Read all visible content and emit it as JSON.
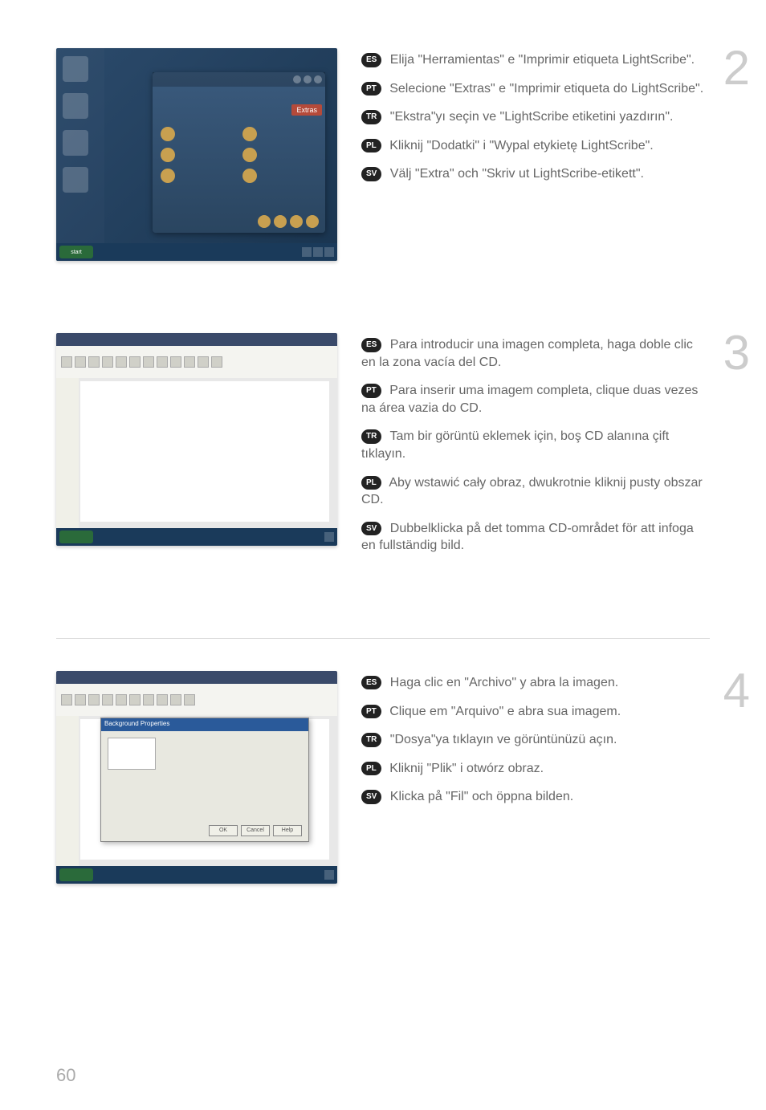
{
  "page_number": "60",
  "steps": [
    {
      "number": "2",
      "image_hint": {
        "type": "desktop",
        "extras_label": "Extras",
        "start_label": "start"
      },
      "instructions": [
        {
          "lang": "ES",
          "text": "Elija \"Herramientas\" e \"Imprimir etiqueta LightScribe\"."
        },
        {
          "lang": "PT",
          "text": "Selecione \"Extras\" e \"Imprimir etiqueta do LightScribe\"."
        },
        {
          "lang": "TR",
          "text": "\"Ekstra\"yı seçin ve \"LightScribe etiketini yazdırın\"."
        },
        {
          "lang": "PL",
          "text": "Kliknij \"Dodatki\" i \"Wypal etykietę LightScribe\"."
        },
        {
          "lang": "SV",
          "text": "Välj \"Extra\" och \"Skriv ut LightScribe-etikett\"."
        }
      ]
    },
    {
      "number": "3",
      "image_hint": {
        "type": "editor-blank"
      },
      "instructions": [
        {
          "lang": "ES",
          "text": "Para introducir una imagen completa, haga doble clic en la zona vacía del CD."
        },
        {
          "lang": "PT",
          "text": "Para inserir uma imagem completa, clique duas vezes na área vazia do CD."
        },
        {
          "lang": "TR",
          "text": "Tam bir görüntü eklemek için, boş CD alanına çift tıklayın."
        },
        {
          "lang": "PL",
          "text": "Aby wstawić cały obraz, dwukrotnie kliknij pusty obszar CD."
        },
        {
          "lang": "SV",
          "text": "Dubbelklicka på det tomma CD-området för att infoga en fullständig bild."
        }
      ]
    },
    {
      "number": "4",
      "image_hint": {
        "type": "editor-dialog",
        "dialog_title": "Background Properties",
        "buttons": [
          "OK",
          "Cancel",
          "Help"
        ]
      },
      "instructions": [
        {
          "lang": "ES",
          "text": "Haga clic en \"Archivo\" y abra la imagen."
        },
        {
          "lang": "PT",
          "text": "Clique em \"Arquivo\" e abra sua imagem."
        },
        {
          "lang": "TR",
          "text": "\"Dosya\"ya tıklayın ve görüntünüzü açın."
        },
        {
          "lang": "PL",
          "text": "Kliknij \"Plik\" i otwórz obraz."
        },
        {
          "lang": "SV",
          "text": "Klicka på \"Fil\" och öppna bilden."
        }
      ]
    }
  ]
}
